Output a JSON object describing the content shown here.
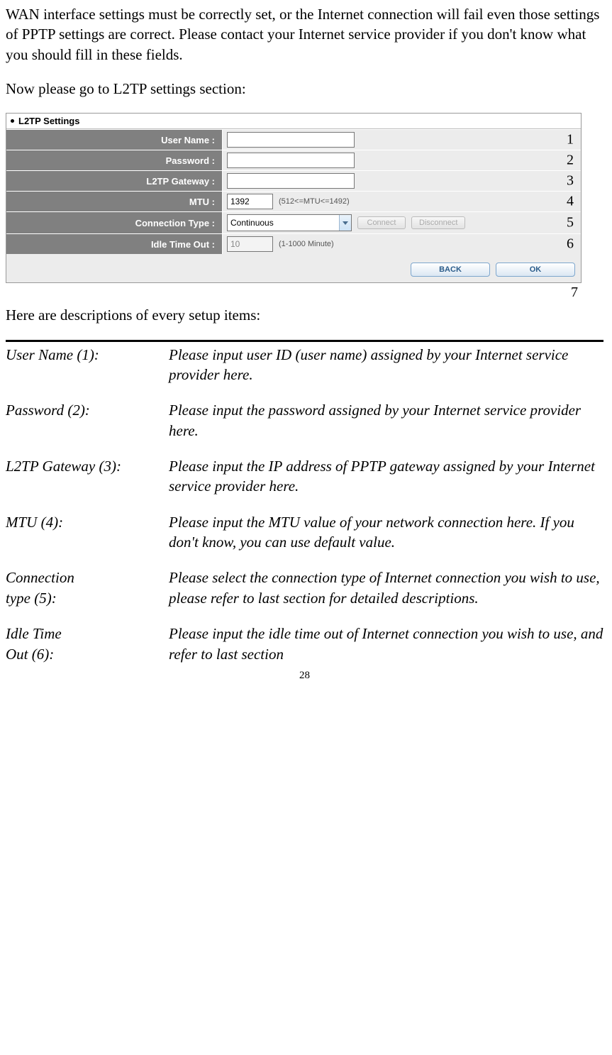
{
  "intro_para": "WAN interface settings must be correctly set, or the Internet connection will fail even those settings of PPTP settings are correct. Please contact your Internet service provider if you don't know what you should fill in these fields.",
  "goto_para": "Now please go to L2TP settings section:",
  "panel": {
    "title": "L2TP Settings",
    "rows": {
      "username": {
        "label": "User Name :",
        "value": "",
        "callout": "1"
      },
      "password": {
        "label": "Password :",
        "value": "",
        "callout": "2"
      },
      "gateway": {
        "label": "L2TP Gateway :",
        "value": "",
        "callout": "3"
      },
      "mtu": {
        "label": "MTU :",
        "value": "1392",
        "hint": "(512<=MTU<=1492)",
        "callout": "4"
      },
      "conntype": {
        "label": "Connection Type :",
        "value": "Continuous",
        "connect": "Connect",
        "disconnect": "Disconnect",
        "callout": "5"
      },
      "idle": {
        "label": "Idle Time Out :",
        "value": "10",
        "hint": "(1-1000 Minute)",
        "callout": "6"
      }
    },
    "footer": {
      "back": "BACK",
      "ok": "OK"
    },
    "callout7": "7"
  },
  "desc_heading": "Here are descriptions of every setup items:",
  "desc": {
    "username": {
      "term": "User Name (1):",
      "def": "Please input user ID (user name) assigned by your Internet service provider here."
    },
    "password": {
      "term": "Password (2):",
      "def": "Please input the password assigned by your Internet service provider here."
    },
    "gateway": {
      "term": "L2TP Gateway (3):",
      "def": "Please input the IP address of PPTP gateway assigned by your Internet service provider here."
    },
    "mtu": {
      "term": "MTU (4):",
      "def": "Please input the MTU value of your network connection here. If you don't know, you can use default value."
    },
    "conntype": {
      "term_l1": "Connection",
      "term_l2": "type (5):",
      "def": "Please select the connection type of Internet connection you wish to use, please refer to last section for detailed descriptions."
    },
    "idle": {
      "term_l1": "Idle Time",
      "term_l2": "Out (6):",
      "def": "Please input the idle time out of Internet connection you wish to use, and refer to last section"
    }
  },
  "page_number": "28"
}
